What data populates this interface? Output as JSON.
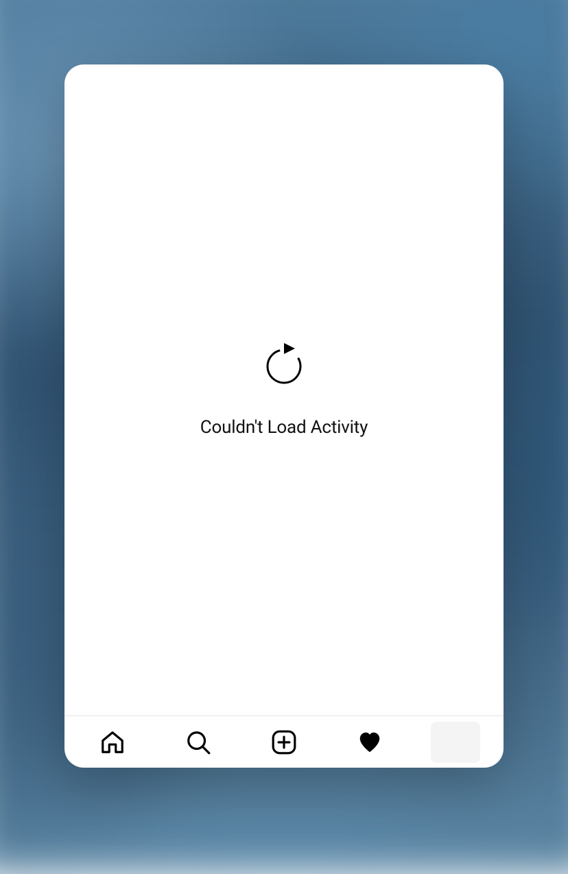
{
  "content": {
    "error_message": "Couldn't Load Activity"
  },
  "icons": {
    "refresh": "refresh-icon",
    "home": "home-icon",
    "search": "search-icon",
    "create": "plus-square-icon",
    "activity": "heart-icon",
    "profile": "avatar-icon"
  },
  "tabbar": {
    "active_tab": "activity"
  }
}
